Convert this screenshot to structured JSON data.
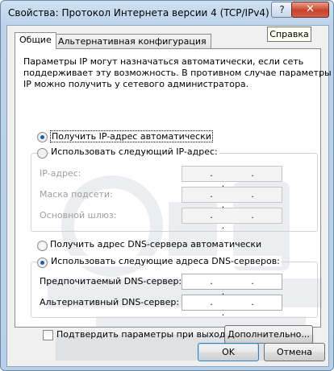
{
  "window": {
    "title": "Свойства: Протокол Интернета версии 4 (TCP/IPv4)",
    "help_glyph": "?",
    "close_glyph": "✕",
    "tooltip": "Справка"
  },
  "tabs": [
    {
      "label": "Общие",
      "active": true
    },
    {
      "label": "Альтернативная конфигурация",
      "active": false
    }
  ],
  "description": [
    "Параметры IP могут назначаться автоматически, если сеть",
    "поддерживает эту возможность. В противном случае параметры",
    "IP можно получить у сетевого администратора."
  ],
  "ip_mode": {
    "auto_label": "Получить IP-адрес автоматически",
    "manual_label": "Использовать следующий IP-адрес:",
    "selected": "auto",
    "fields": [
      {
        "label": "IP-адрес:",
        "value": ". . ."
      },
      {
        "label": "Маска подсети:",
        "value": ". . ."
      },
      {
        "label": "Основной шлюз:",
        "value": ". . ."
      }
    ]
  },
  "dns_mode": {
    "auto_label": "Получить адрес DNS-сервера автоматически",
    "manual_label": "Использовать следующие адреса DNS-серверов:",
    "selected": "manual",
    "fields": [
      {
        "label": "Предпочитаемый DNS-сервер:",
        "value": ". . ."
      },
      {
        "label": "Альтернативный DNS-сервер:",
        "value": ". . ."
      }
    ]
  },
  "validate_label": "Подтвердить параметры при выходе",
  "validate_checked": false,
  "advanced_label": "Дополнительно...",
  "ok_label": "OK",
  "cancel_label": "Отмена",
  "colors": {
    "title_bar": "#bcd3ea",
    "close_button": "#c7432b",
    "radio_dot": "#1b5bb0"
  }
}
